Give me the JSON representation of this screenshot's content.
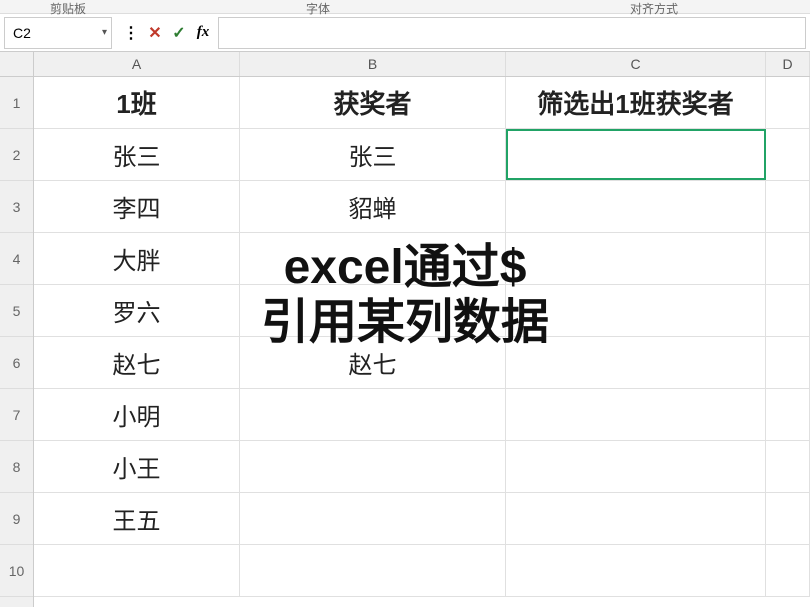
{
  "ribbon": {
    "tabs": [
      "剪贴板",
      "字体",
      "对齐方式"
    ]
  },
  "formula_bar": {
    "name_box": "C2",
    "fx": "fx"
  },
  "icons": {
    "dots": "⋮",
    "cancel": "✕",
    "check": "✓"
  },
  "columns": [
    "A",
    "B",
    "C",
    "D"
  ],
  "rows": [
    "1",
    "2",
    "3",
    "4",
    "5",
    "6",
    "7",
    "8",
    "9",
    "10"
  ],
  "sheet": {
    "header": {
      "a": "1班",
      "b": "获奖者",
      "c": "筛选出1班获奖者"
    },
    "colA": [
      "张三",
      "李四",
      "大胖",
      "罗六",
      "赵七",
      "小明",
      "小王",
      "王五"
    ],
    "colB": [
      "张三",
      "貂蝉",
      "",
      "",
      "赵七",
      "",
      "",
      ""
    ]
  },
  "overlay": {
    "line1": "excel通过$",
    "line2": "引用某列数据"
  }
}
